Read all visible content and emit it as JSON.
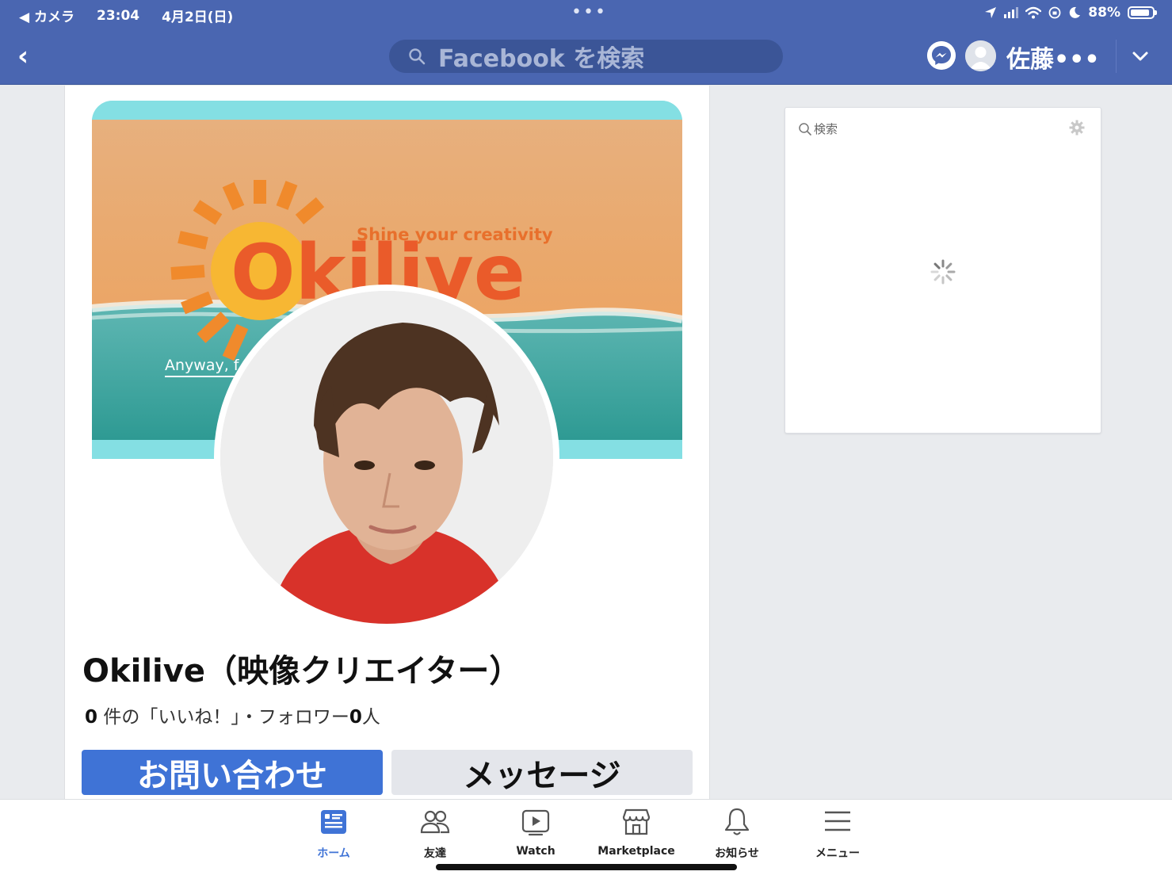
{
  "status_bar": {
    "back_app": "◀ カメラ",
    "time": "23:04",
    "date": "4月2日(日)",
    "battery": "88%",
    "battery_level": 0.88,
    "dots": "•••"
  },
  "header": {
    "back_glyph": "‹",
    "search_placeholder": "Facebook を検索",
    "user_name": "佐藤•••",
    "colors": {
      "bar": "#4a66b1",
      "search": "#3b5597"
    }
  },
  "cover": {
    "brand": "Okilive",
    "tagline": "Shine your creativity",
    "subline": "Anyway, f"
  },
  "profile": {
    "page_name": "Okilive（映像クリエイター）",
    "likes_count": "0",
    "likes_label": " 件の「いいね！」・フォロワー",
    "followers_count": "0",
    "followers_unit": "人",
    "contact_button": "お問い合わせ",
    "message_button": "メッセージ",
    "accent": "#3f73d6"
  },
  "side_panel": {
    "search_placeholder": "検索"
  },
  "bottom_nav": {
    "items": [
      {
        "label": "ホーム",
        "icon": "home-feed-icon",
        "active": true
      },
      {
        "label": "友達",
        "icon": "friends-icon",
        "active": false
      },
      {
        "label": "Watch",
        "icon": "watch-play-icon",
        "active": false
      },
      {
        "label": "Marketplace",
        "icon": "marketplace-store-icon",
        "active": false
      },
      {
        "label": "お知らせ",
        "icon": "bell-icon",
        "active": false
      },
      {
        "label": "メニュー",
        "icon": "menu-hamburger-icon",
        "active": false
      }
    ]
  }
}
